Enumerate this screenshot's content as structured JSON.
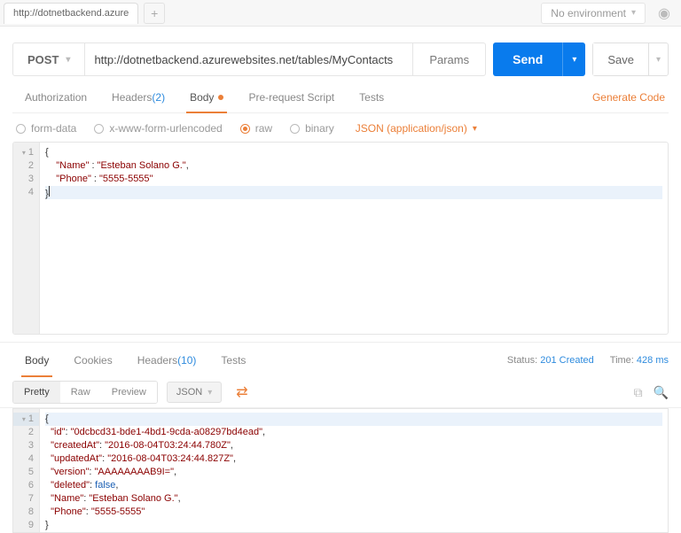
{
  "topbar": {
    "tab_title": "http://dotnetbackend.azure",
    "env_label": "No environment"
  },
  "request": {
    "method": "POST",
    "url": "http://dotnetbackend.azurewebsites.net/tables/MyContacts",
    "params_label": "Params",
    "send_label": "Send",
    "save_label": "Save"
  },
  "tabs": {
    "authorization": "Authorization",
    "headers": "Headers ",
    "headers_count": "(2)",
    "body": "Body",
    "prerequest": "Pre-request Script",
    "tests": "Tests",
    "generate_code": "Generate Code"
  },
  "body_opts": {
    "form_data": "form-data",
    "urlencoded": "x-www-form-urlencoded",
    "raw": "raw",
    "binary": "binary",
    "content_type": "JSON (application/json)"
  },
  "request_body": {
    "lines": [
      "1",
      "2",
      "3",
      "4"
    ],
    "k1": "\"Name\"",
    "v1": "\"Esteban Solano G.\"",
    "k2": "\"Phone\"",
    "v2": "\"5555-5555\""
  },
  "response_tabs": {
    "body": "Body",
    "cookies": "Cookies",
    "headers": "Headers ",
    "headers_count": "(10)",
    "tests": "Tests"
  },
  "status": {
    "status_label": "Status: ",
    "status_value": "201 Created",
    "time_label": "Time: ",
    "time_value": "428 ms"
  },
  "pretty_bar": {
    "pretty": "Pretty",
    "raw": "Raw",
    "preview": "Preview",
    "format": "JSON"
  },
  "response_body": {
    "lines": [
      "1",
      "2",
      "3",
      "4",
      "5",
      "6",
      "7",
      "8",
      "9"
    ],
    "k_id": "\"id\"",
    "v_id": "\"0dcbcd31-bde1-4bd1-9cda-a08297bd4ead\"",
    "k_created": "\"createdAt\"",
    "v_created": "\"2016-08-04T03:24:44.780Z\"",
    "k_updated": "\"updatedAt\"",
    "v_updated": "\"2016-08-04T03:24:44.827Z\"",
    "k_version": "\"version\"",
    "v_version": "\"AAAAAAAAB9I=\"",
    "k_deleted": "\"deleted\"",
    "v_deleted": "false",
    "k_name": "\"Name\"",
    "v_name": "\"Esteban Solano G.\"",
    "k_phone": "\"Phone\"",
    "v_phone": "\"5555-5555\""
  }
}
